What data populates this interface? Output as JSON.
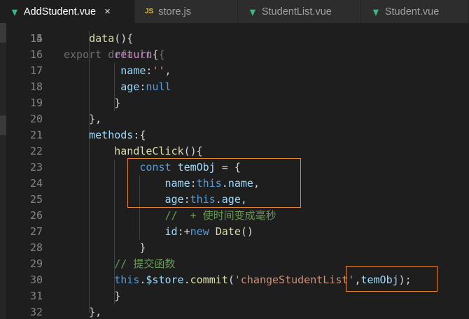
{
  "tabs": [
    {
      "label": "AddStudent.vue",
      "icon": "vue-icon",
      "active": true,
      "close": "×"
    },
    {
      "label": "store.js",
      "icon": "js-icon",
      "icon_text": "JS",
      "active": false
    },
    {
      "label": "StudentList.vue",
      "icon": "vue-icon",
      "active": false
    },
    {
      "label": "Student.vue",
      "icon": "vue-icon",
      "active": false
    }
  ],
  "colors": {
    "keyword": "#569cd6",
    "control": "#c586c0",
    "function": "#dcdcaa",
    "property": "#9cdcfe",
    "string": "#ce9178",
    "comment": "#6a9955",
    "highlight_box": "#e8862f",
    "vue_icon": "#41b883"
  },
  "code": {
    "top_partial": "export default {",
    "lines": [
      {
        "num": "15",
        "indent": "    ",
        "tokens": [
          {
            "t": "data",
            "c": "f"
          },
          {
            "t": "(){",
            "c": "t"
          }
        ]
      },
      {
        "num": "16",
        "indent": "        ",
        "tokens": [
          {
            "t": "return",
            "c": "kc"
          },
          {
            "t": "{",
            "c": "t"
          }
        ]
      },
      {
        "num": "17",
        "indent": "         ",
        "tokens": [
          {
            "t": "name",
            "c": "p"
          },
          {
            "t": ":",
            "c": "t"
          },
          {
            "t": "''",
            "c": "s"
          },
          {
            "t": ",",
            "c": "t"
          }
        ]
      },
      {
        "num": "18",
        "indent": "         ",
        "tokens": [
          {
            "t": "age",
            "c": "p"
          },
          {
            "t": ":",
            "c": "t"
          },
          {
            "t": "null",
            "c": "k"
          }
        ]
      },
      {
        "num": "19",
        "indent": "        ",
        "tokens": [
          {
            "t": "}",
            "c": "t"
          }
        ]
      },
      {
        "num": "20",
        "indent": "    ",
        "tokens": [
          {
            "t": "},",
            "c": "t"
          }
        ]
      },
      {
        "num": "21",
        "indent": "    ",
        "tokens": [
          {
            "t": "methods",
            "c": "p"
          },
          {
            "t": ":{",
            "c": "t"
          }
        ]
      },
      {
        "num": "22",
        "indent": "        ",
        "tokens": [
          {
            "t": "handleClick",
            "c": "f"
          },
          {
            "t": "(){",
            "c": "t"
          }
        ]
      },
      {
        "num": "23",
        "indent": "            ",
        "tokens": [
          {
            "t": "const",
            "c": "k"
          },
          {
            "t": " ",
            "c": "t"
          },
          {
            "t": "temObj",
            "c": "p"
          },
          {
            "t": " = {",
            "c": "t"
          }
        ]
      },
      {
        "num": "24",
        "indent": "                ",
        "tokens": [
          {
            "t": "name",
            "c": "p"
          },
          {
            "t": ":",
            "c": "t"
          },
          {
            "t": "this",
            "c": "k"
          },
          {
            "t": ".",
            "c": "t"
          },
          {
            "t": "name",
            "c": "p"
          },
          {
            "t": ",",
            "c": "t"
          }
        ]
      },
      {
        "num": "25",
        "indent": "                ",
        "tokens": [
          {
            "t": "age",
            "c": "p"
          },
          {
            "t": ":",
            "c": "t"
          },
          {
            "t": "this",
            "c": "k"
          },
          {
            "t": ".",
            "c": "t"
          },
          {
            "t": "age",
            "c": "p"
          },
          {
            "t": ",",
            "c": "t"
          }
        ]
      },
      {
        "num": "26",
        "indent": "                ",
        "tokens": [
          {
            "t": "//  + 使时间变成毫秒",
            "c": "c"
          }
        ]
      },
      {
        "num": "27",
        "indent": "                ",
        "tokens": [
          {
            "t": "id",
            "c": "p"
          },
          {
            "t": ":+",
            "c": "t"
          },
          {
            "t": "new",
            "c": "k"
          },
          {
            "t": " ",
            "c": "t"
          },
          {
            "t": "Date",
            "c": "f"
          },
          {
            "t": "()",
            "c": "t"
          }
        ]
      },
      {
        "num": "28",
        "indent": "            ",
        "tokens": [
          {
            "t": "}",
            "c": "t"
          }
        ]
      },
      {
        "num": "29",
        "indent": "        ",
        "tokens": [
          {
            "t": "// 提交函数",
            "c": "c"
          }
        ]
      },
      {
        "num": "30",
        "indent": "        ",
        "tokens": [
          {
            "t": "this",
            "c": "k"
          },
          {
            "t": ".",
            "c": "t"
          },
          {
            "t": "$store",
            "c": "p"
          },
          {
            "t": ".",
            "c": "t"
          },
          {
            "t": "commit",
            "c": "f"
          },
          {
            "t": "(",
            "c": "t"
          },
          {
            "t": "'changeStudentList'",
            "c": "s"
          },
          {
            "t": ",",
            "c": "t"
          },
          {
            "t": "temObj",
            "c": "p"
          },
          {
            "t": ");",
            "c": "t"
          }
        ]
      },
      {
        "num": "31",
        "indent": "        ",
        "tokens": [
          {
            "t": "}",
            "c": "t"
          }
        ]
      },
      {
        "num": "32",
        "indent": "    ",
        "tokens": [
          {
            "t": "},",
            "c": "t"
          }
        ]
      }
    ]
  }
}
